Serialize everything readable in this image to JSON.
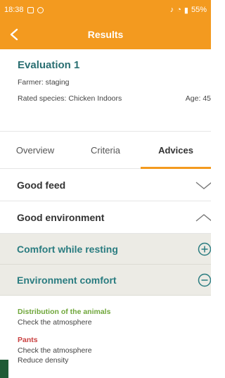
{
  "status_bar": {
    "time": "18:38",
    "battery": "55%"
  },
  "app_bar": {
    "title": "Results",
    "back_icon": "chevron-left-icon"
  },
  "evaluation": {
    "title": "Evaluation 1",
    "farmer": "Farmer: staging",
    "species": "Rated species: Chicken Indoors",
    "age": "Age: 45"
  },
  "tabs": [
    {
      "label": "Overview",
      "active": false
    },
    {
      "label": "Criteria",
      "active": false
    },
    {
      "label": "Advices",
      "active": true
    }
  ],
  "sections": {
    "good_feed": {
      "label": "Good feed",
      "state": "collapsed"
    },
    "good_environment": {
      "label": "Good environment",
      "state": "expanded"
    },
    "comfort_resting": {
      "label": "Comfort while resting",
      "state": "collapsed"
    },
    "environment_comfort": {
      "label": "Environment comfort",
      "state": "expanded"
    }
  },
  "advices": [
    {
      "title": "Distribution of the animals",
      "color": "#6fa63a",
      "lines": [
        "Check the atmosphere"
      ]
    },
    {
      "title": "Pants",
      "color": "#c94040",
      "lines": [
        "Check the atmosphere",
        "Reduce density"
      ]
    }
  ],
  "colors": {
    "accent": "#f39a1f",
    "teal": "#2a6f72",
    "sub_bg": "#ecebe5"
  }
}
